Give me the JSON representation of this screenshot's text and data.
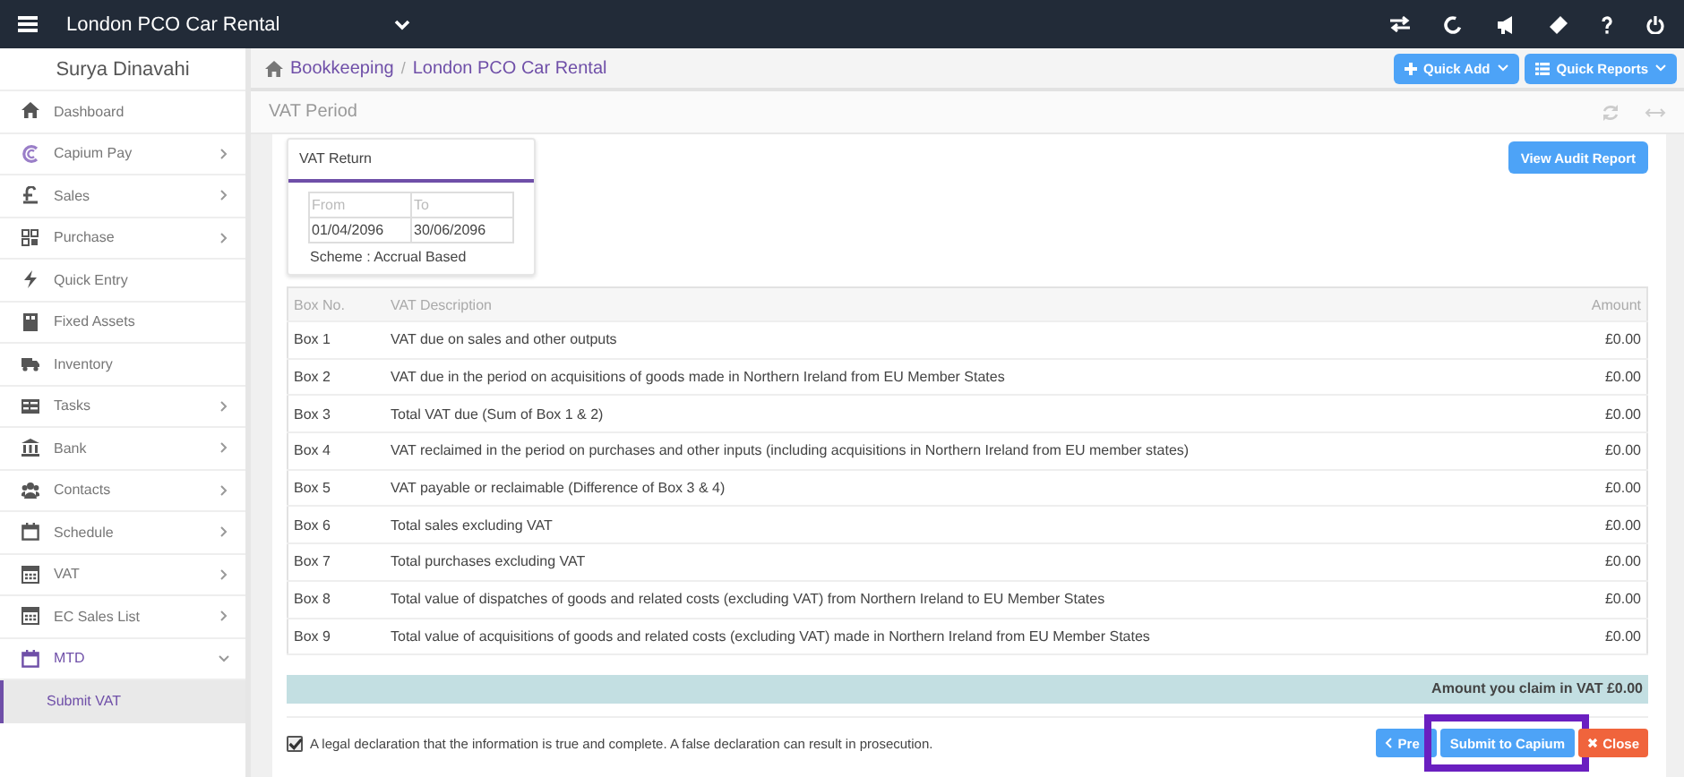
{
  "topbar": {
    "company": "London PCO Car Rental"
  },
  "sidebar": {
    "user": "Surya Dinavahi",
    "items": [
      {
        "label": "Dashboard",
        "has_children": false,
        "expanded": false
      },
      {
        "label": "Capium Pay",
        "has_children": true,
        "expanded": false
      },
      {
        "label": "Sales",
        "has_children": true,
        "expanded": false
      },
      {
        "label": "Purchase",
        "has_children": true,
        "expanded": false
      },
      {
        "label": "Quick Entry",
        "has_children": false,
        "expanded": false
      },
      {
        "label": "Fixed Assets",
        "has_children": false,
        "expanded": false
      },
      {
        "label": "Inventory",
        "has_children": false,
        "expanded": false
      },
      {
        "label": "Tasks",
        "has_children": true,
        "expanded": false
      },
      {
        "label": "Bank",
        "has_children": true,
        "expanded": false
      },
      {
        "label": "Contacts",
        "has_children": true,
        "expanded": false
      },
      {
        "label": "Schedule",
        "has_children": true,
        "expanded": false
      },
      {
        "label": "VAT",
        "has_children": true,
        "expanded": false
      },
      {
        "label": "EC Sales List",
        "has_children": true,
        "expanded": false
      },
      {
        "label": "MTD",
        "has_children": true,
        "expanded": true,
        "children": [
          {
            "label": "Submit VAT",
            "selected": true
          }
        ]
      }
    ]
  },
  "breadcrumb": {
    "separator": "/",
    "items": [
      "Bookkeeping",
      "London PCO Car Rental"
    ]
  },
  "header_buttons": [
    "Quick Add",
    "Quick Reports"
  ],
  "panel_title": "VAT Period",
  "vat_return": {
    "title": "VAT Return",
    "columns": [
      "From",
      "To"
    ],
    "values": [
      "01/04/2096",
      "30/06/2096"
    ],
    "scheme": "Scheme : Accrual Based"
  },
  "audit_button": "View Audit Report",
  "table": {
    "columns": [
      "Box No.",
      "VAT Description",
      "Amount"
    ],
    "rows": [
      [
        "Box 1",
        "VAT due on sales and other outputs",
        "£0.00"
      ],
      [
        "Box 2",
        "VAT due in the period on acquisitions of goods made in Northern Ireland from EU Member States",
        "£0.00"
      ],
      [
        "Box 3",
        "Total VAT due (Sum of Box 1 & 2)",
        "£0.00"
      ],
      [
        "Box 4",
        "VAT reclaimed in the period on purchases and other inputs (including acquisitions in Northern Ireland from EU member states)",
        "£0.00"
      ],
      [
        "Box 5",
        "VAT payable or reclaimable (Difference of Box 3 & 4)",
        "£0.00"
      ],
      [
        "Box 6",
        "Total sales excluding VAT",
        "£0.00"
      ],
      [
        "Box 7",
        "Total purchases excluding VAT",
        "£0.00"
      ],
      [
        "Box 8",
        "Total value of dispatches of goods and related costs (excluding VAT) from Northern Ireland to EU Member States",
        "£0.00"
      ],
      [
        "Box 9",
        "Total value of acquisitions of goods and related costs (excluding VAT) made in Northern Ireland from EU Member States",
        "£0.00"
      ]
    ]
  },
  "claim_total": "Amount you claim in VAT £0.00",
  "declaration": {
    "text": "A legal declaration that the information is true and complete. A false declaration can result in prosecution.",
    "checked": true
  },
  "footer_buttons": [
    {
      "kind": "prev",
      "label": "Pre"
    },
    {
      "kind": "submit",
      "label": "Submit to Capium",
      "highlighted": true
    },
    {
      "kind": "close",
      "label": "Close"
    }
  ]
}
